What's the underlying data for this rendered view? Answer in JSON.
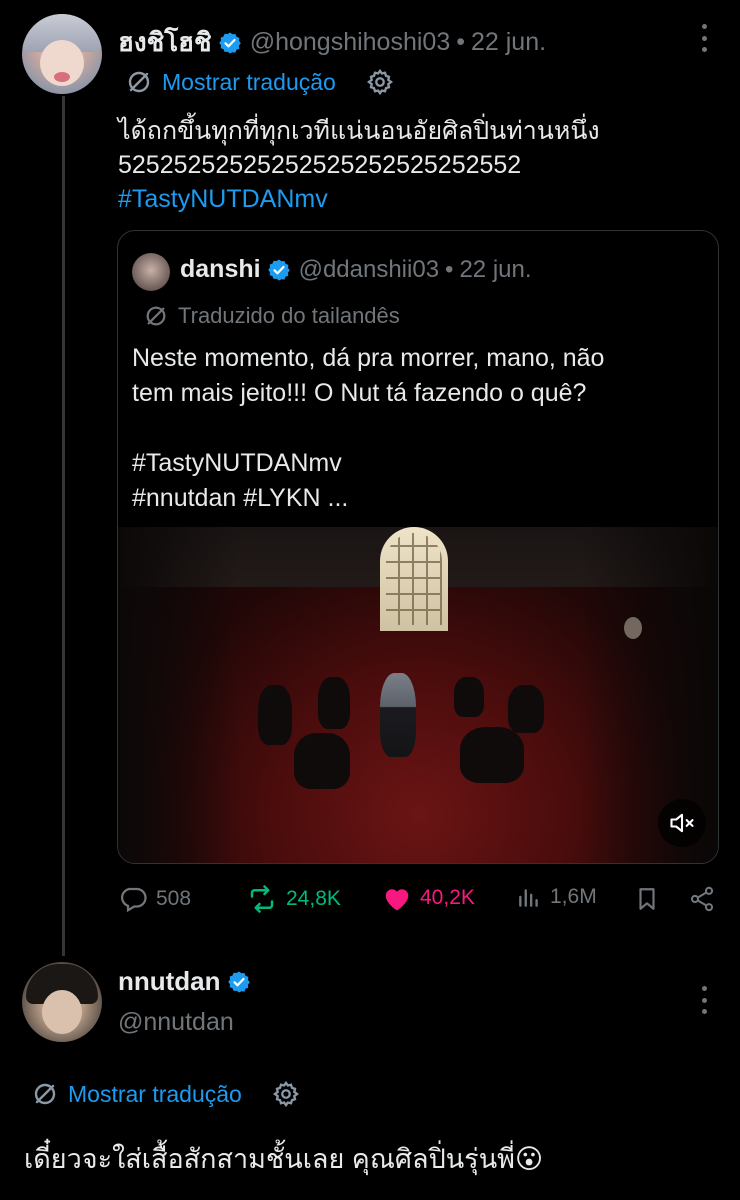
{
  "tweet1": {
    "display_name": "ฮงชิโฮชิ",
    "handle": "@hongshihoshi03",
    "separator": "•",
    "date": "22 jun.",
    "translate_link": "Mostrar tradução",
    "text_line1": "ได้ถกขึ้นทุกที่ทุกเวทีแน่นอนอัยศิลปิ่นท่านหนึ่ง",
    "text_line2": "52525252525252525252525252552",
    "hashtag": "#TastyNUTDANmv"
  },
  "quote": {
    "display_name": "danshi",
    "handle": "@ddanshii03",
    "separator": "•",
    "date": "22 jun.",
    "translated_label": "Traduzido do tailandês",
    "text_line1": "Neste momento, dá pra morrer, mano, não",
    "text_line2": "tem mais jeito!!! O Nut tá fazendo o quê?",
    "hashtag_line1": "#TastyNUTDANmv",
    "hashtag_line2": "#nnutdan #LYKN ..."
  },
  "actions": {
    "replies": "508",
    "reposts": "24,8K",
    "likes": "40,2K",
    "views": "1,6M"
  },
  "tweet2": {
    "display_name": "nnutdan",
    "handle": "@nnutdan",
    "translate_link": "Mostrar tradução",
    "text": "เดี๋ยวจะใส่เสื้อสักสามชั้นเลย คุณศิลปิ่นรุ่นพี่",
    "emoji": "😮"
  },
  "colors": {
    "background": "#000000",
    "text": "#e7e9ea",
    "muted": "#71767b",
    "link": "#1d9bf0",
    "repost": "#00ba7c",
    "like": "#f91880"
  },
  "icons": [
    "verified-badge-icon",
    "more-icon",
    "translate-icon",
    "gear-icon",
    "reply-icon",
    "repost-icon",
    "like-icon",
    "views-icon",
    "bookmark-icon",
    "share-icon",
    "mute-icon"
  ]
}
